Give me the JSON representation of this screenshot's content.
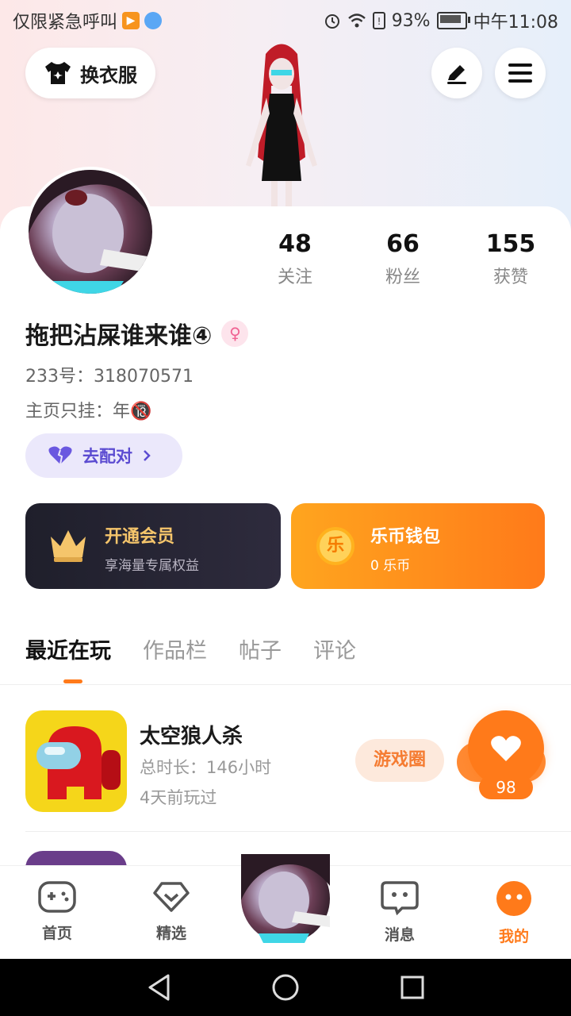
{
  "status_bar": {
    "left_text": "仅限紧急呼叫",
    "battery": "93%",
    "time": "中午11:08"
  },
  "header": {
    "outfit_label": "换衣服",
    "edit_icon": "pencil-icon",
    "menu_icon": "menu-icon"
  },
  "profile": {
    "stats": [
      {
        "value": "48",
        "label": "关注"
      },
      {
        "value": "66",
        "label": "粉丝"
      },
      {
        "value": "155",
        "label": "获赞"
      }
    ],
    "name": "拖把沾屎谁来谁④",
    "gender_symbol": "♀",
    "uid": "233号：318070571",
    "bio": "主页只挂：年🔞",
    "match_label": "去配对"
  },
  "cards": {
    "vip_title": "开通会员",
    "vip_sub": "享海量专属权益",
    "wallet_title": "乐币钱包",
    "wallet_sub": "0 乐币",
    "wallet_coin": "乐"
  },
  "tabs": [
    "最近在玩",
    "作品栏",
    "帖子",
    "评论"
  ],
  "games": [
    {
      "name": "太空狼人杀",
      "total_time": "总时长：146小时",
      "last_played": "4天前玩过",
      "circle_label": "游戏圈",
      "likes": "98"
    }
  ],
  "bottom_nav": [
    {
      "label": "首页",
      "icon": "gamepad-icon"
    },
    {
      "label": "精选",
      "icon": "heart-diamond-icon"
    },
    {
      "label": "消息",
      "icon": "chat-icon"
    },
    {
      "label": "我的",
      "icon": "profile-dots-icon"
    }
  ],
  "colors": {
    "accent": "#ff7a1a",
    "match": "#5b4bd1",
    "vip_gold": "#f5c56b"
  }
}
